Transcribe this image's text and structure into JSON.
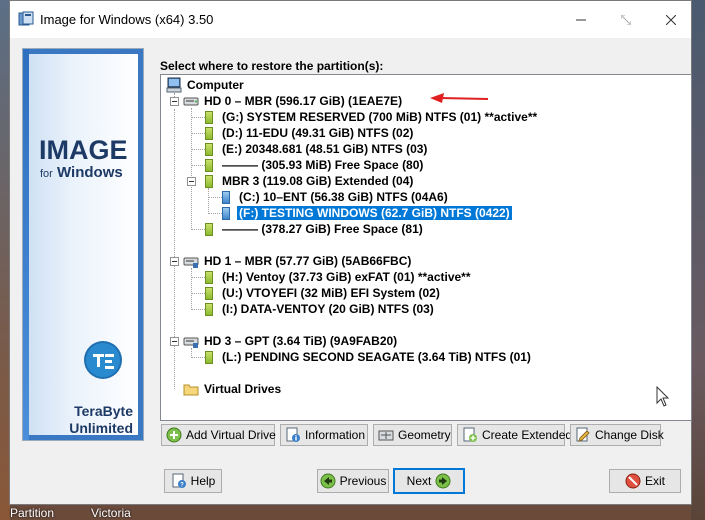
{
  "window": {
    "title": "Image for Windows (x64) 3.50"
  },
  "banner": {
    "title": "IMAGE",
    "sub_for": "for",
    "sub_windows": "Windows",
    "company_line1": "TeraByte",
    "company_line2": "Unlimited"
  },
  "prompt": "Select where to restore the partition(s):",
  "tree": {
    "computer": "Computer",
    "hd0": "HD 0 – MBR (596.17 GiB) (1EAE7E)",
    "hd0_items": [
      "(G:) SYSTEM RESERVED (700 MiB) NTFS (01) **active**",
      "(D:) 11-EDU (49.31 GiB) NTFS (02)",
      "(E:) 20348.681 (48.51 GiB) NTFS (03)",
      "——— (305.93 MiB) Free Space (80)"
    ],
    "mbr3": "MBR 3 (119.08 GiB) Extended (04)",
    "mbr3_items": [
      "(C:) 10–ENT (56.38 GiB) NTFS (04A6)",
      "(F:) TESTING WINDOWS (62.7 GiB) NTFS (0422)"
    ],
    "hd0_free2": "——— (378.27 GiB) Free Space (81)",
    "hd1": "HD 1 – MBR (57.77 GiB) (5AB66FBC)",
    "hd1_items": [
      "(H:) Ventoy (37.73 GiB) exFAT (01) **active**",
      "(U:) VTOYEFI (32 MiB) EFI System (02)",
      "(I:) DATA-VENTOY (20 GiB) NTFS (03)"
    ],
    "hd3": "HD 3 – GPT (3.64 TiB) (9A9FAB20)",
    "hd3_items": [
      "(L:) PENDING SECOND SEAGATE (3.64 TiB) NTFS (01)"
    ],
    "virtual": "Virtual Drives"
  },
  "toolbar": {
    "add_virtual": "Add Virtual Drive",
    "information": "Information",
    "geometry": "Geometry",
    "create_extended": "Create Extended",
    "change_disk": "Change Disk"
  },
  "nav": {
    "help": "Help",
    "previous": "Previous",
    "next": "Next",
    "exit": "Exit"
  },
  "taskbar": {
    "item1": "Partition",
    "item2": "Victoria"
  },
  "colors": {
    "selection": "#0078d7",
    "arrow": "#e02020",
    "banner_text": "#1d3a66"
  }
}
